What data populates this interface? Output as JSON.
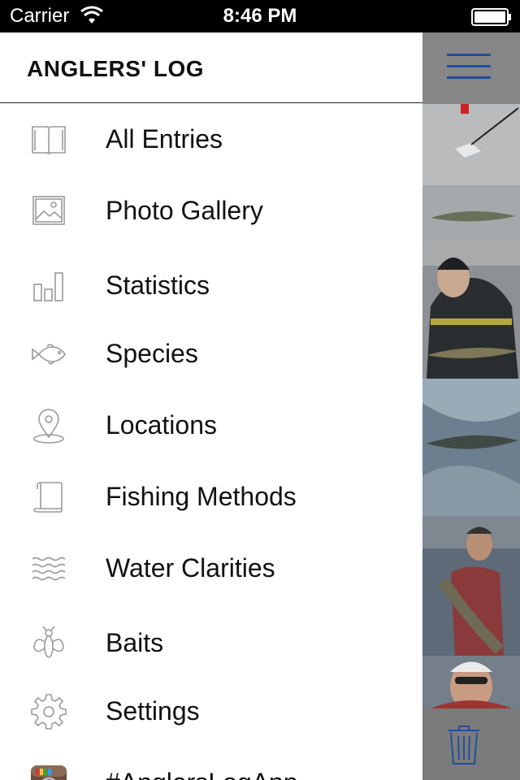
{
  "status_bar": {
    "carrier": "Carrier",
    "time": "8:46 PM"
  },
  "drawer": {
    "title": "ANGLERS' LOG",
    "items": [
      {
        "label": "All Entries",
        "icon": "book-icon"
      },
      {
        "label": "Photo Gallery",
        "icon": "image-icon"
      },
      {
        "label": "Statistics",
        "icon": "bar-chart-icon"
      },
      {
        "label": "Species",
        "icon": "fish-icon"
      },
      {
        "label": "Locations",
        "icon": "map-pin-icon"
      },
      {
        "label": "Fishing Methods",
        "icon": "scroll-icon"
      },
      {
        "label": "Water Clarities",
        "icon": "waves-icon"
      },
      {
        "label": "Baits",
        "icon": "fly-icon"
      },
      {
        "label": "Settings",
        "icon": "gear-icon"
      },
      {
        "label": "#AnglersLogApp",
        "icon": "instagram-icon"
      }
    ]
  },
  "content": {
    "menu_icon": "hamburger-icon",
    "toolbar_icon": "trash-icon"
  },
  "colors": {
    "accent": "#1f4f9c",
    "icon_gray": "#9a9a9a",
    "status_bar_bg": "#000000"
  }
}
